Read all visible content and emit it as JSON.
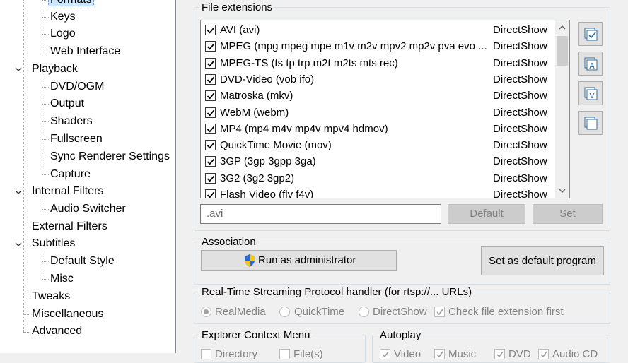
{
  "tree": {
    "formats": "Formats",
    "keys": "Keys",
    "logo": "Logo",
    "web_interface": "Web Interface",
    "playback": "Playback",
    "dvd_ogm": "DVD/OGM",
    "output": "Output",
    "shaders": "Shaders",
    "fullscreen": "Fullscreen",
    "sync_renderer": "Sync Renderer Settings",
    "capture": "Capture",
    "internal_filters": "Internal Filters",
    "audio_switcher": "Audio Switcher",
    "external_filters": "External Filters",
    "subtitles": "Subtitles",
    "default_style": "Default Style",
    "misc": "Misc",
    "tweaks": "Tweaks",
    "miscellaneous": "Miscellaneous",
    "advanced": "Advanced"
  },
  "file_extensions": {
    "title": "File extensions",
    "rows": [
      {
        "name": "AVI (avi)",
        "filter": "DirectShow"
      },
      {
        "name": "MPEG (mpg mpeg mpe m1v m2v mpv2 mp2v pva evo ...",
        "filter": "DirectShow"
      },
      {
        "name": "MPEG-TS (ts tp trp m2t m2ts mts rec)",
        "filter": "DirectShow"
      },
      {
        "name": "DVD-Video (vob ifo)",
        "filter": "DirectShow"
      },
      {
        "name": "Matroska (mkv)",
        "filter": "DirectShow"
      },
      {
        "name": "WebM (webm)",
        "filter": "DirectShow"
      },
      {
        "name": "MP4 (mp4 m4v mp4v mpv4 hdmov)",
        "filter": "DirectShow"
      },
      {
        "name": "QuickTime Movie (mov)",
        "filter": "DirectShow"
      },
      {
        "name": "3GP (3gp 3gpp 3ga)",
        "filter": "DirectShow"
      },
      {
        "name": "3G2 (3g2 3gp2)",
        "filter": "DirectShow"
      },
      {
        "name": "Flash Video (flv f4v)",
        "filter": "DirectShow"
      }
    ],
    "extension_value": ".avi",
    "default_button": "Default",
    "set_button": "Set",
    "side_buttons": [
      "select-all-icon",
      "audio-formats-icon",
      "video-formats-icon",
      "clear-all-icon"
    ]
  },
  "association": {
    "title": "Association",
    "run_as_admin": "Run as administrator",
    "set_default_program": "Set as default program"
  },
  "rtsp": {
    "title": "Real-Time Streaming Protocol handler (for rtsp://... URLs)",
    "options": [
      "RealMedia",
      "QuickTime",
      "DirectShow"
    ],
    "selected": "RealMedia",
    "check_ext_first": "Check file extension first"
  },
  "explorer_context_menu": {
    "title": "Explorer Context Menu",
    "items": [
      "Directory",
      "File(s)"
    ]
  },
  "autoplay": {
    "title": "Autoplay",
    "items": [
      "Video",
      "Music",
      "DVD",
      "Audio CD"
    ]
  },
  "colors": {
    "selected_bg": "#cce8ff",
    "disabled_text": "#838383",
    "window_bg": "#f0f0f0"
  }
}
